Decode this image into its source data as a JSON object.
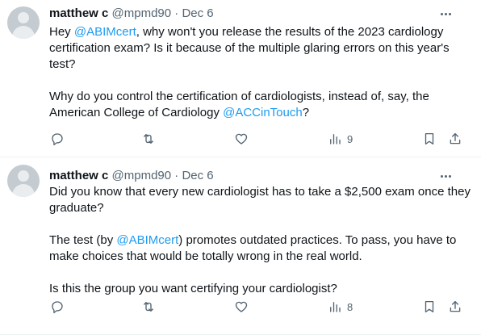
{
  "tweets": [
    {
      "author": {
        "name": "matthew c",
        "handle": "@mpmd90",
        "separator": "·",
        "date": "Dec 6"
      },
      "body": [
        [
          {
            "text": "Hey "
          },
          {
            "text": "@ABIMcert",
            "mention": true
          },
          {
            "text": ", why won't you release the results of the 2023 cardiology certification exam? Is it because of the multiple glaring errors on this year's test?"
          }
        ],
        [
          {
            "text": "Why do you control the certification of cardiologists, instead of, say, the American College of Cardiology "
          },
          {
            "text": "@ACCinTouch",
            "mention": true
          },
          {
            "text": "?"
          }
        ]
      ],
      "actions": {
        "views_count": "9"
      }
    },
    {
      "author": {
        "name": "matthew c",
        "handle": "@mpmd90",
        "separator": "·",
        "date": "Dec 6"
      },
      "body": [
        [
          {
            "text": "Did you know that every new cardiologist has to take a $2,500 exam once they graduate?"
          }
        ],
        [
          {
            "text": "The test (by "
          },
          {
            "text": "@ABIMcert",
            "mention": true
          },
          {
            "text": ") promotes outdated practices. To pass, you have to make choices that would be totally wrong in the real world."
          }
        ],
        [
          {
            "text": "Is this the group you want certifying your cardiologist?"
          }
        ]
      ],
      "actions": {
        "views_count": "8"
      }
    }
  ],
  "icons": {
    "reply": "reply-icon",
    "retweet": "retweet-icon",
    "like": "heart-icon",
    "views": "views-icon",
    "bookmark": "bookmark-icon",
    "share": "share-icon",
    "more": "more-icon"
  },
  "colors": {
    "mention": "#1d9bf0",
    "secondary_text": "#536471",
    "primary_text": "#0f1419",
    "divider": "#eff3f4"
  }
}
